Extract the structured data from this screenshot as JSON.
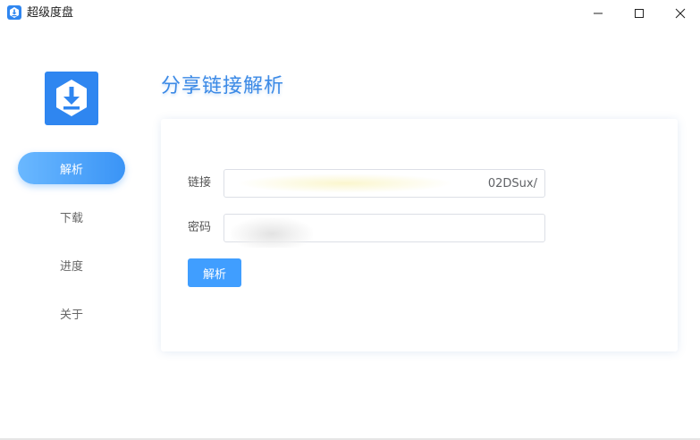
{
  "window": {
    "title": "超级度盘",
    "controls": {
      "minimize": "minimize-icon",
      "maximize": "maximize-icon",
      "close": "close-icon"
    }
  },
  "sidebar": {
    "logo_icon": "download-icon",
    "items": [
      {
        "label": "解析",
        "active": true
      },
      {
        "label": "下载",
        "active": false
      },
      {
        "label": "进度",
        "active": false
      },
      {
        "label": "关于",
        "active": false
      }
    ]
  },
  "main": {
    "title": "分享链接解析",
    "form": {
      "link_label": "链接",
      "link_value": "02DSux/",
      "password_label": "密码",
      "password_value": "",
      "submit_label": "解析"
    }
  },
  "colors": {
    "accent": "#409eff",
    "title": "#3c8ae6",
    "logo_bg": "#2f86f0"
  }
}
